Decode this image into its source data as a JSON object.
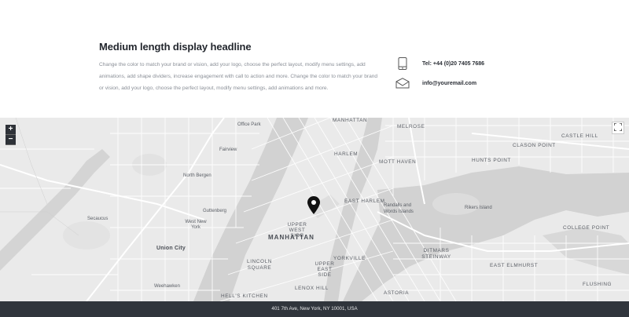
{
  "section": {
    "headline": "Medium length display headline",
    "body": "Change the color to match your brand or vision, add your logo, choose the perfect layout, modify menu settings, add animations, add shape dividers, increase engagement with call to action and more. Change the color to match your brand or vision, add your logo, choose the perfect layout, modify menu settings, add animations and more."
  },
  "contact": {
    "phone": "Tel: +44 (0)20 7405 7686",
    "email": "info@youremail.com",
    "phone_icon": "phone-icon",
    "email_icon": "envelope-icon"
  },
  "map": {
    "zoom_in": "+",
    "zoom_out": "−",
    "labels": {
      "office_park": "Office Park",
      "manhattan_top": "MANHATTAN",
      "melrose": "MELROSE",
      "castle_hill": "CASTLE HILL",
      "clason_point": "CLASON POINT",
      "fairview": "Fairview",
      "harlem": "HARLEM",
      "mott_haven": "MOTT HAVEN",
      "hunts_point": "HUNTS POINT",
      "north_bergen": "North Bergen",
      "east_harlem": "EAST HARLEM",
      "randalls": "Randalls and Words Islands",
      "rikers": "Rikers Island",
      "secaucus": "Secaucus",
      "guttenberg": "Guttenberg",
      "west_new_york": "West New York",
      "upper_west_side": "UPPER WEST SIDE",
      "manhattan": "MANHATTAN",
      "college_point": "COLLEGE POINT",
      "union_city": "Union City",
      "lincoln_square": "LINCOLN SQUARE",
      "yorkville": "YORKVILLE",
      "upper_east_side": "UPPER EAST SIDE",
      "ditmars": "DITMARS STEINWAY",
      "east_elmhurst": "EAST ELMHURST",
      "weehawken": "Weehawken",
      "hells_kitchen": "HELL'S KITCHEN",
      "lenox_hill": "LENOX HILL",
      "astoria": "ASTORIA",
      "flushing": "FLUSHING"
    },
    "pin_icon": "map-pin-icon",
    "fullscreen_icon": "fullscreen-icon"
  },
  "footer": {
    "address": "401 7th Ave, New York, NY 10001, USA"
  }
}
